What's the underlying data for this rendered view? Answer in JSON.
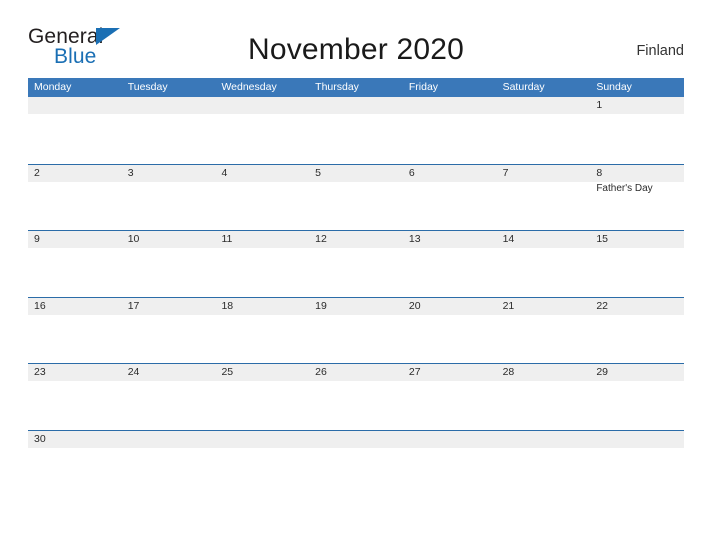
{
  "brand": {
    "name_part1": "General",
    "name_part2": "Blue",
    "triangle_icon": "triangle-icon",
    "color_dark": "#231f20",
    "color_blue": "#1a6fb4"
  },
  "header": {
    "title": "November 2020",
    "region": "Finland"
  },
  "theme": {
    "header_blue": "#3a78b9",
    "divider_blue": "#2b6ca8",
    "date_band_gray": "#efefef",
    "page_background": "#ffffff",
    "text_color": "#2b2b2b"
  },
  "calendar": {
    "month": "November",
    "year": "2020",
    "weekday_headers": [
      "Monday",
      "Tuesday",
      "Wednesday",
      "Thursday",
      "Friday",
      "Saturday",
      "Sunday"
    ],
    "weeks": [
      {
        "days": [
          {
            "date": "",
            "events": []
          },
          {
            "date": "",
            "events": []
          },
          {
            "date": "",
            "events": []
          },
          {
            "date": "",
            "events": []
          },
          {
            "date": "",
            "events": []
          },
          {
            "date": "",
            "events": []
          },
          {
            "date": "1",
            "events": []
          }
        ]
      },
      {
        "days": [
          {
            "date": "2",
            "events": []
          },
          {
            "date": "3",
            "events": []
          },
          {
            "date": "4",
            "events": []
          },
          {
            "date": "5",
            "events": []
          },
          {
            "date": "6",
            "events": []
          },
          {
            "date": "7",
            "events": []
          },
          {
            "date": "8",
            "events": [
              "Father's Day"
            ]
          }
        ]
      },
      {
        "days": [
          {
            "date": "9",
            "events": []
          },
          {
            "date": "10",
            "events": []
          },
          {
            "date": "11",
            "events": []
          },
          {
            "date": "12",
            "events": []
          },
          {
            "date": "13",
            "events": []
          },
          {
            "date": "14",
            "events": []
          },
          {
            "date": "15",
            "events": []
          }
        ]
      },
      {
        "days": [
          {
            "date": "16",
            "events": []
          },
          {
            "date": "17",
            "events": []
          },
          {
            "date": "18",
            "events": []
          },
          {
            "date": "19",
            "events": []
          },
          {
            "date": "20",
            "events": []
          },
          {
            "date": "21",
            "events": []
          },
          {
            "date": "22",
            "events": []
          }
        ]
      },
      {
        "days": [
          {
            "date": "23",
            "events": []
          },
          {
            "date": "24",
            "events": []
          },
          {
            "date": "25",
            "events": []
          },
          {
            "date": "26",
            "events": []
          },
          {
            "date": "27",
            "events": []
          },
          {
            "date": "28",
            "events": []
          },
          {
            "date": "29",
            "events": []
          }
        ]
      },
      {
        "days": [
          {
            "date": "30",
            "events": []
          },
          {
            "date": "",
            "events": []
          },
          {
            "date": "",
            "events": []
          },
          {
            "date": "",
            "events": []
          },
          {
            "date": "",
            "events": []
          },
          {
            "date": "",
            "events": []
          },
          {
            "date": "",
            "events": []
          }
        ]
      }
    ]
  }
}
